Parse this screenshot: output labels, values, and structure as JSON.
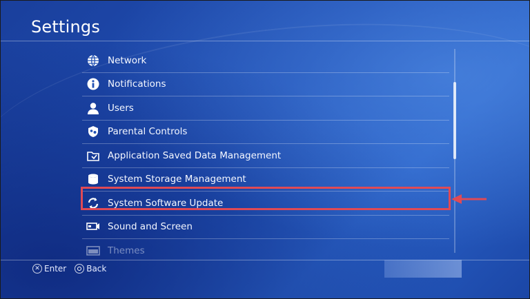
{
  "header": {
    "title": "Settings"
  },
  "menu": {
    "items": [
      {
        "label": "Network",
        "icon": "globe-icon"
      },
      {
        "label": "Notifications",
        "icon": "info-icon"
      },
      {
        "label": "Users",
        "icon": "user-icon"
      },
      {
        "label": "Parental Controls",
        "icon": "shield-icon"
      },
      {
        "label": "Application Saved Data Management",
        "icon": "folder-icon"
      },
      {
        "label": "System Storage Management",
        "icon": "storage-icon"
      },
      {
        "label": "System Software Update",
        "icon": "refresh-icon",
        "highlighted": true
      },
      {
        "label": "Sound and Screen",
        "icon": "sound-screen-icon"
      },
      {
        "label": "Themes",
        "icon": "themes-icon"
      }
    ]
  },
  "footer": {
    "enter_label": "Enter",
    "back_label": "Back"
  },
  "colors": {
    "highlight": "#e04a55",
    "background": "#1f4fb5"
  }
}
